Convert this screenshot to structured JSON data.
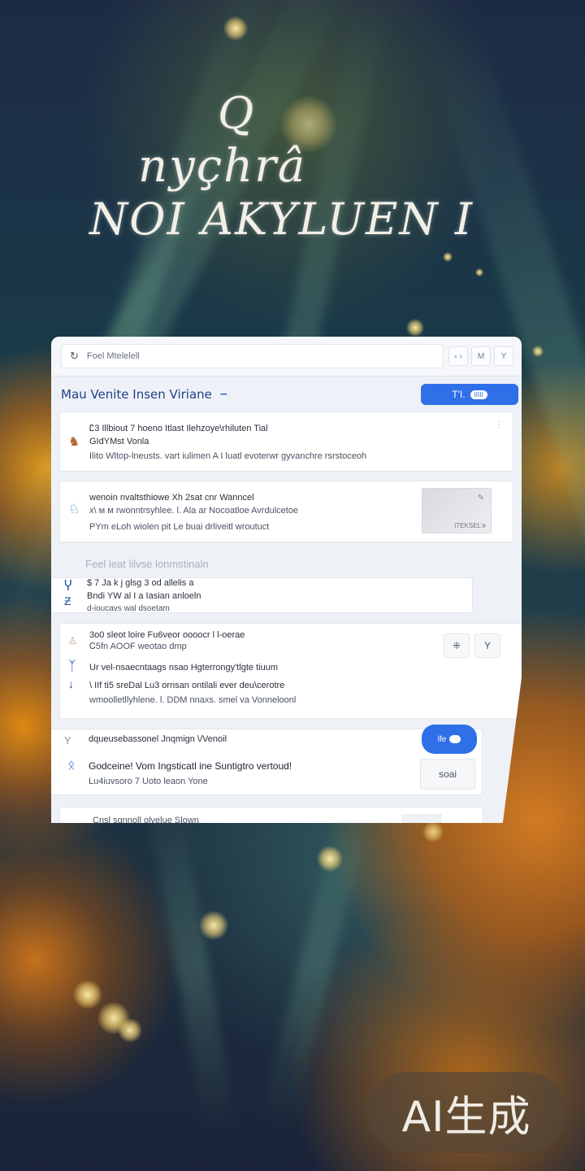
{
  "background": {
    "scrawl_line1": "nyçhrâ",
    "scrawl_line2": "NOI AKYLUEN I",
    "scrawl_mark": "Q",
    "accent_orange": "#f0a020",
    "accent_teal": "#3a7a78"
  },
  "window": {
    "address_text": "Foel Mtelelell",
    "refresh_icon": "refresh-icon",
    "controls": [
      "‹ ›",
      "M",
      "Y"
    ],
    "header_title": "Mau Venite Insen Viriane",
    "header_dash": "–",
    "primary_button_label": "T'I.",
    "primary_button_pill": "IIIII",
    "accent_blue": "#2f6fe8"
  },
  "items": [
    {
      "line1": "Ꮭ3 Illbiout 7 hoeno Itlast Ilehzoye\\rhiluten Tial",
      "line2": "GIdYMst Vonla",
      "line3": "Ilito Wltop-lneusts. vart iulimen A I luatl evoterwr gyvanchre rsrstoceoh"
    },
    {
      "line1": "wenoin nvaltsthiowe Xh 2sat cnr Wanncel",
      "line2": "x\\ ᴍ  ᴍ rwonntrsyhlee. l. Ala ar Nocoatloe Avrdulcetoe",
      "line3": "PYm eLoh wiolen pit Le buai drliveitl wroutuct",
      "thumb_caption": "ITEKSEL'e"
    }
  ],
  "section_label": "Feel leat lilvse lonmstinaln",
  "group1": {
    "line1": "$ 7 Ja k j glsg 3 od allelis a",
    "line2": "Bndi YW al I a  Iasian anloeln",
    "line3": "d-ioucavs wal dsoetam"
  },
  "group2": {
    "line1": "3o0 sleot loire Fu6veor oooocr l l-oerae",
    "line2": "Ꮯ5fn AOOF weotao dmp",
    "line3": "Ur vel-nsaecntaags nsao Hgterrongy'tlgte tiuum",
    "line4": "\\ IIf ti5 sreDal Lu3 ornsan ontilali ever deu\\cerotre",
    "line5": "wmoolletllyhlene.  l.  DDM nnaxs.  smel va Vonneloonl",
    "box_a": "⁜",
    "box_b": "Y"
  },
  "group3": {
    "line1": "dqueusebassonel Jnqmign  \\/Venoil",
    "line2": "Godceine! Vom Ingsticatl ine Suntigtro vertoud!",
    "line3": "Lu4iuvsoro 7 Uoto leaon Yone",
    "pill_label": "lfe",
    "pill_icon": "toggle-icon",
    "ghost_label": "soai"
  },
  "group4": {
    "line1": "Cnsl sgnnoll olvelue Slown"
  },
  "watermark": "AI生成"
}
